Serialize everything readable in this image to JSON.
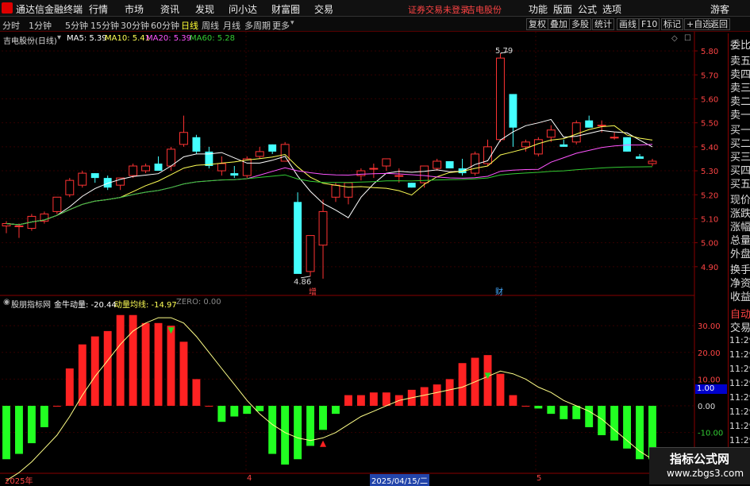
{
  "menubar": {
    "app_title": "通达信金融终端",
    "items": [
      "行情",
      "市场",
      "资讯",
      "发现",
      "问小达",
      "财富圈",
      "交易"
    ],
    "notice": "证券交易未登录",
    "stock": "吉电股份",
    "right_items": [
      "功能",
      "版面",
      "公式",
      "选项"
    ],
    "guest": "游客"
  },
  "toolbar": {
    "periods": [
      "分时",
      "1分钟",
      "5分钟",
      "15分钟",
      "30分钟",
      "60分钟",
      "日线",
      "周线",
      "月线",
      "多周期",
      "更多"
    ],
    "active_period": "日线",
    "right_buttons": [
      "复权",
      "叠加",
      "多股",
      "统计",
      "画线",
      "F10",
      "标记",
      "+自选",
      "返回"
    ]
  },
  "main_chart": {
    "title": "吉电股份(日线)",
    "ma5_label": "MA5: 5.39",
    "ma10_label": "MA10: 5.41",
    "ma20_label": "MA20: 5.39",
    "ma60_label": "MA60: 5.28",
    "high_label": "5.79",
    "low_label": "4.86",
    "marker_zeng": "增",
    "marker_cai": "财"
  },
  "indicator": {
    "title": "股朋指标网",
    "main_label": "金牛动量: -20.44",
    "avg_label": "动量均线: -14.97",
    "zero_label": "ZERO: 0.00",
    "cursor_value": "1.00"
  },
  "date_axis": {
    "start": "2025年",
    "month4": "4",
    "cursor_date": "2025/04/15/二",
    "month5": "5"
  },
  "sidebar": {
    "items": [
      "委比",
      "卖五",
      "卖四",
      "卖三",
      "卖二",
      "卖一",
      "买一",
      "买二",
      "买三",
      "买四",
      "买五",
      "现价",
      "涨跌",
      "涨幅",
      "总量",
      "外盘",
      "换手",
      "净资",
      "收益",
      "自动",
      "交易"
    ],
    "times": [
      "11:29",
      "11:29",
      "11:29",
      "11:29",
      "11:29",
      "11:29",
      "11:29",
      "11:29"
    ]
  },
  "watermark": {
    "line1": "指标公式网",
    "line2": "www.zbgs3.com"
  },
  "colors": {
    "up": "#ff3333",
    "down": "#44ffff",
    "ma5": "#ffffff",
    "ma10": "#ffff55",
    "ma20": "#ff55ff",
    "ma60": "#33cc33",
    "pos_bar": "#ff2222",
    "neg_bar": "#22ff22"
  },
  "chart_data": [
    {
      "type": "candlestick",
      "title": "吉电股份(日线)",
      "ylim": [
        4.82,
        5.84
      ],
      "y_ticks": [
        4.9,
        5.0,
        5.1,
        5.2,
        5.3,
        5.4,
        5.5,
        5.6,
        5.7,
        5.8
      ],
      "ohlc": [
        [
          5.07,
          5.09,
          5.04,
          5.08
        ],
        [
          5.07,
          5.08,
          5.02,
          5.07
        ],
        [
          5.06,
          5.12,
          5.05,
          5.11
        ],
        [
          5.09,
          5.13,
          5.08,
          5.12
        ],
        [
          5.13,
          5.19,
          5.12,
          5.19
        ],
        [
          5.2,
          5.27,
          5.19,
          5.26
        ],
        [
          5.24,
          5.3,
          5.23,
          5.29
        ],
        [
          5.29,
          5.29,
          5.25,
          5.27
        ],
        [
          5.27,
          5.28,
          5.22,
          5.23
        ],
        [
          5.24,
          5.27,
          5.22,
          5.27
        ],
        [
          5.28,
          5.33,
          5.27,
          5.32
        ],
        [
          5.3,
          5.33,
          5.29,
          5.32
        ],
        [
          5.33,
          5.36,
          5.31,
          5.3
        ],
        [
          5.32,
          5.4,
          5.3,
          5.39
        ],
        [
          5.41,
          5.53,
          5.4,
          5.46
        ],
        [
          5.44,
          5.45,
          5.37,
          5.38
        ],
        [
          5.38,
          5.4,
          5.31,
          5.32
        ],
        [
          5.3,
          5.36,
          5.28,
          5.33
        ],
        [
          5.29,
          5.32,
          5.27,
          5.28
        ],
        [
          5.28,
          5.36,
          5.27,
          5.35
        ],
        [
          5.36,
          5.4,
          5.35,
          5.38
        ],
        [
          5.41,
          5.41,
          5.37,
          5.38
        ],
        [
          5.34,
          5.42,
          5.34,
          5.41
        ],
        [
          5.17,
          5.21,
          4.88,
          4.87
        ],
        [
          4.88,
          5.03,
          4.86,
          5.03
        ],
        [
          4.99,
          5.18,
          4.85,
          5.13
        ],
        [
          5.19,
          5.25,
          5.17,
          5.24
        ],
        [
          5.19,
          5.25,
          5.16,
          5.25
        ],
        [
          5.28,
          5.31,
          5.26,
          5.3
        ],
        [
          5.31,
          5.33,
          5.27,
          5.31
        ],
        [
          5.32,
          5.35,
          5.3,
          5.35
        ],
        [
          5.28,
          5.31,
          5.25,
          5.28
        ],
        [
          5.25,
          5.25,
          5.23,
          5.23
        ],
        [
          5.25,
          5.32,
          5.23,
          5.32
        ],
        [
          5.31,
          5.35,
          5.3,
          5.34
        ],
        [
          5.34,
          5.33,
          5.31,
          5.31
        ],
        [
          5.31,
          5.35,
          5.28,
          5.29
        ],
        [
          5.29,
          5.38,
          5.28,
          5.37
        ],
        [
          5.33,
          5.43,
          5.32,
          5.4
        ],
        [
          5.43,
          5.79,
          5.42,
          5.77
        ],
        [
          5.62,
          5.62,
          5.4,
          5.48
        ],
        [
          5.4,
          5.43,
          5.38,
          5.42
        ],
        [
          5.37,
          5.44,
          5.36,
          5.43
        ],
        [
          5.44,
          5.49,
          5.42,
          5.47
        ],
        [
          5.41,
          5.43,
          5.4,
          5.4
        ],
        [
          5.42,
          5.51,
          5.41,
          5.5
        ],
        [
          5.51,
          5.53,
          5.48,
          5.48
        ],
        [
          5.49,
          5.51,
          5.46,
          5.49
        ],
        [
          5.44,
          5.46,
          5.43,
          5.44
        ],
        [
          5.44,
          5.44,
          5.38,
          5.38
        ],
        [
          5.36,
          5.37,
          5.35,
          5.35
        ],
        [
          5.33,
          5.35,
          5.32,
          5.34
        ]
      ],
      "high": 5.79,
      "low": 4.86
    },
    {
      "type": "bar",
      "title": "股朋指标网",
      "ylim": [
        -22,
        36
      ],
      "y_ticks": [
        -10,
        0,
        10,
        20,
        30
      ],
      "values": [
        -20,
        -18,
        -14,
        -8,
        0,
        14,
        23,
        26,
        28,
        34,
        34,
        31,
        31,
        30,
        24,
        10,
        0,
        -6,
        -4,
        -3,
        -2,
        -18,
        -22,
        -20,
        -15,
        -9,
        -3,
        4,
        4,
        5,
        5,
        4,
        6,
        7,
        8,
        10,
        16,
        18,
        19,
        12,
        4,
        0,
        -1,
        -3,
        -5,
        -5,
        -8,
        -11,
        -13,
        -16,
        -20,
        -20
      ],
      "avg_series": [
        -28,
        -25,
        -21,
        -16,
        -11,
        -4,
        4,
        11,
        17,
        23,
        28,
        31,
        33,
        33,
        31,
        26,
        20,
        14,
        8,
        2,
        -3,
        -7,
        -10,
        -12,
        -13,
        -12,
        -10,
        -7,
        -4,
        -2,
        0,
        2,
        3,
        4,
        5,
        6,
        7,
        9,
        11,
        13,
        12,
        10,
        7,
        5,
        2,
        0,
        -2,
        -5,
        -9,
        -13,
        -17,
        -20
      ],
      "zero": 0
    }
  ]
}
